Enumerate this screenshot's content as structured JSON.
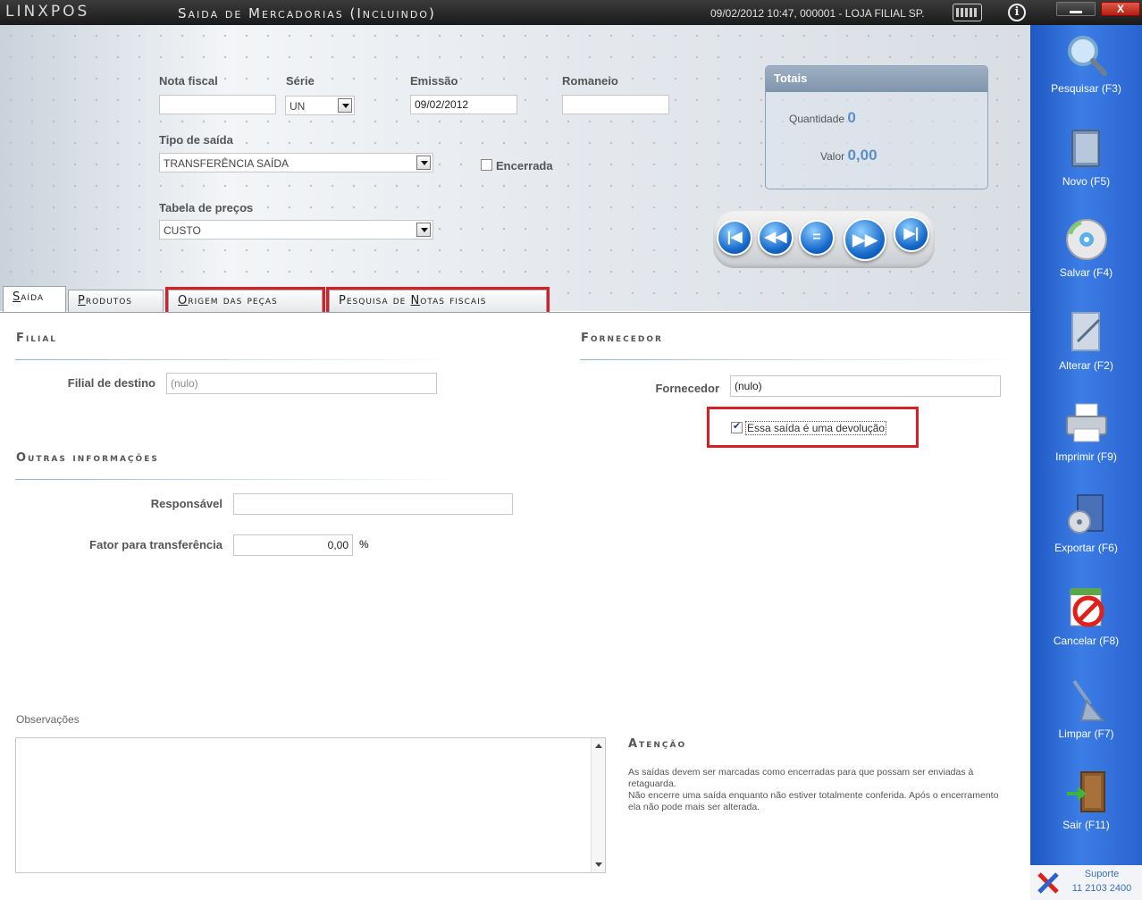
{
  "window": {
    "brand": "LINXPOS",
    "title": "Saida de Mercadorias (Incluindo)",
    "status": "09/02/2012 10:47, 000001 - LOJA FILIAL SP.",
    "close_label": "X"
  },
  "header": {
    "nota_fiscal_label": "Nota fiscal",
    "nota_fiscal_value": "",
    "serie_label": "Série",
    "serie_value": "UN",
    "emissao_label": "Emissão",
    "emissao_value": "09/02/2012",
    "romaneio_label": "Romaneio",
    "romaneio_value": "",
    "tipo_saida_label": "Tipo de saída",
    "tipo_saida_value": "TRANSFERÊNCIA SAÍDA",
    "encerrada_label": "Encerrada",
    "encerrada_checked": false,
    "tabela_precos_label": "Tabela de preços",
    "tabela_precos_value": "CUSTO"
  },
  "totals": {
    "title": "Totais",
    "quantidade_label": "Quantidade",
    "quantidade_value": "0",
    "valor_label": "Valor",
    "valor_value": "0,00"
  },
  "navigation": {
    "first": "|◀",
    "previous": "◀◀",
    "current": "=",
    "next": "▶▶",
    "last": "▶|"
  },
  "tabs": [
    {
      "label_u": "S",
      "label_rest": "aída"
    },
    {
      "label_u": "P",
      "label_rest": "rodutos"
    },
    {
      "label_u": "O",
      "label_rest": "rigem das peças"
    },
    {
      "label_pre": "Pesquisa de ",
      "label_u": "N",
      "label_rest": "otas fiscais"
    }
  ],
  "saida": {
    "filial_section": "Filial",
    "filial_destino_label": "Filial de destino",
    "filial_destino_value": "(nulo)",
    "fornecedor_section": "Fornecedor",
    "fornecedor_label": "Fornecedor",
    "fornecedor_value": "(nulo)",
    "devolucao_label": "Essa saída é uma devolução",
    "devolucao_checked": true,
    "outras_section": "Outras informações",
    "responsavel_label": "Responsável",
    "responsavel_value": "",
    "fator_label": "Fator para transferência",
    "fator_value": "0,00",
    "fator_unit": "%",
    "observacoes_label": "Observações",
    "observacoes_value": "",
    "atencao_title": "Atenção",
    "atencao_line1": "As saídas devem ser marcadas como encerradas para que possam ser enviadas à retaguarda.",
    "atencao_line2": "Não encerre uma saída enquanto não estiver totalmente conferida. Após o encerramento ela não pode mais ser alterada."
  },
  "sidebar": {
    "buttons": [
      {
        "label": "Pesquisar (F3)",
        "icon": "magnifier-icon"
      },
      {
        "label": "Novo (F5)",
        "icon": "book-icon"
      },
      {
        "label": "Salvar (F4)",
        "icon": "disc-icon"
      },
      {
        "label": "Alterar (F2)",
        "icon": "edit-document-icon"
      },
      {
        "label": "Imprimir (F9)",
        "icon": "printer-icon"
      },
      {
        "label": "Exportar (F6)",
        "icon": "export-box-icon"
      },
      {
        "label": "Cancelar (F8)",
        "icon": "cancel-icon"
      },
      {
        "label": "Limpar (F7)",
        "icon": "broom-icon"
      },
      {
        "label": "Sair (F11)",
        "icon": "exit-door-icon"
      }
    ],
    "support_label": "Suporte",
    "support_phone": "11 2103 2400"
  },
  "colors": {
    "accent": "#2a63cf",
    "highlight": "#d81f26",
    "totals_value": "#5b8fc7"
  }
}
